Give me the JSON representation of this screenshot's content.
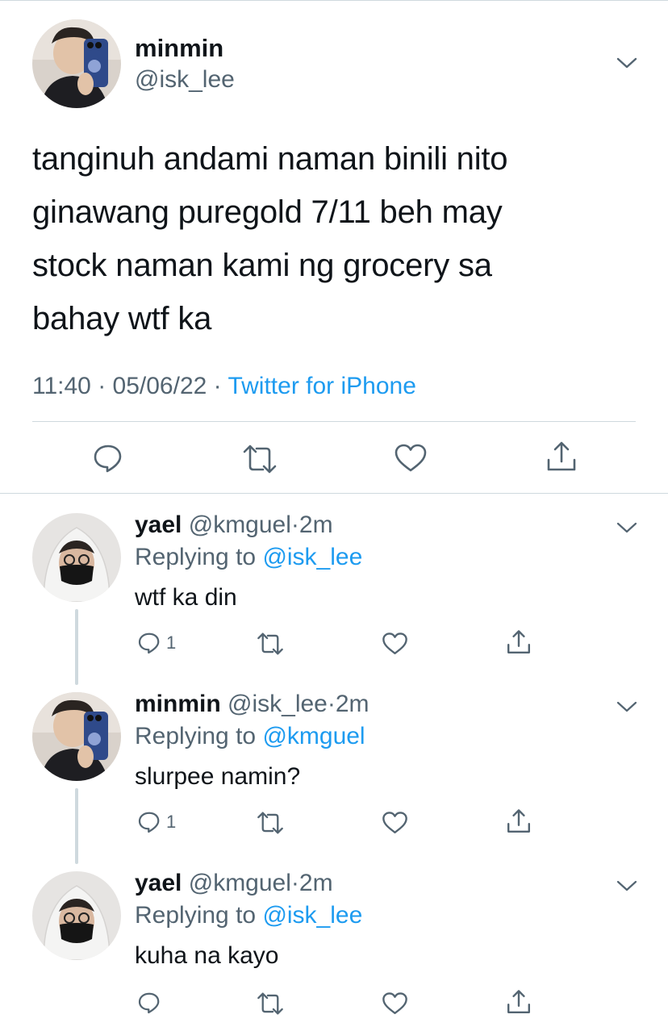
{
  "main_tweet": {
    "name": "minmin",
    "handle": "@isk_lee",
    "text": "tanginuh andami naman binili nito\nginawang puregold 7/11 beh may\nstock naman kami ng grocery sa\nbahay wtf ka",
    "time": "11:40",
    "date": "05/06/22",
    "separator": "·",
    "source": "Twitter for iPhone",
    "actions": [
      "reply-icon",
      "retweet-icon",
      "like-icon",
      "share-icon"
    ]
  },
  "replies": [
    {
      "name": "yael",
      "handle": "@kmguel",
      "age": "2m",
      "replying_label": "Replying to ",
      "replying_to": "@isk_lee",
      "text": "wtf ka din",
      "reply_count": "1"
    },
    {
      "name": "minmin",
      "handle": "@isk_lee",
      "age": "2m",
      "replying_label": "Replying to ",
      "replying_to": "@kmguel",
      "text": "slurpee namin?",
      "reply_count": "1"
    },
    {
      "name": "yael",
      "handle": "@kmguel",
      "age": "2m",
      "replying_label": "Replying to ",
      "replying_to": "@isk_lee",
      "text": "kuha na kayo",
      "reply_count": ""
    }
  ],
  "colors": {
    "text": "#0f1419",
    "secondary": "#536471",
    "accent": "#1d9bf0",
    "divider": "#cfd9de"
  }
}
